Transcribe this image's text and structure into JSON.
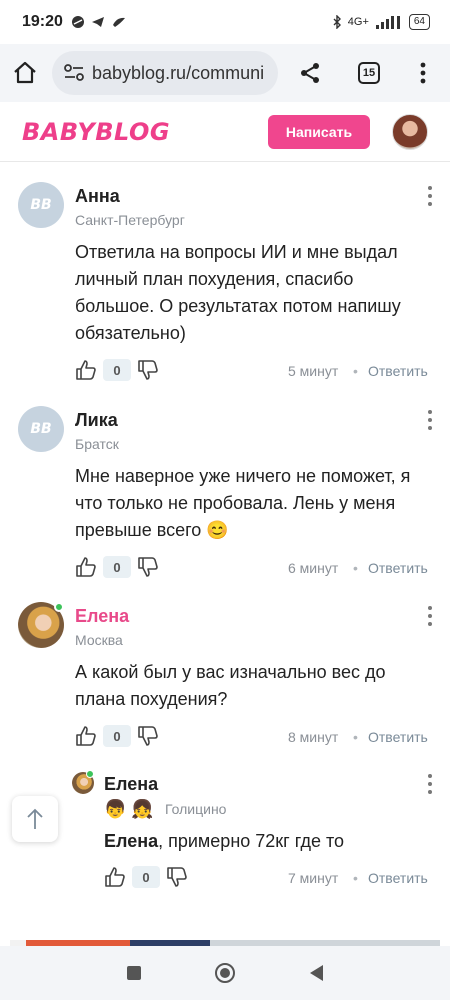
{
  "status_bar": {
    "time": "19:20",
    "battery": "64",
    "network": "4G+"
  },
  "browser": {
    "url": "babyblog.ru/communi",
    "tab_count": "15"
  },
  "header": {
    "logo": "BABYBLOG",
    "write_button": "Написать"
  },
  "comments": [
    {
      "author": "Анна",
      "city": "Санкт-Петербург",
      "avatar": "BB",
      "text": "Ответила на вопросы ИИ и мне выдал личный план похудения, спасибо большое. О результатах потом напишу обязательно)",
      "votes": "0",
      "time": "5 минут",
      "reply": "Ответить"
    },
    {
      "author": "Лика",
      "city": "Братск",
      "avatar": "BB",
      "text": "Мне наверное уже ничего не поможет, я что только не пробовала. Лень у меня превыше всего 😊",
      "votes": "0",
      "time": "6 минут",
      "reply": "Ответить"
    },
    {
      "author": "Елена",
      "city": "Москва",
      "text": "А какой был у вас изначально вес до плана похудения?",
      "votes": "0",
      "time": "8 минут",
      "reply": "Ответить"
    }
  ],
  "reply": {
    "author": "Елена",
    "city": "Голицино",
    "mention": "Елена",
    "text": ", примерно 72кг где то",
    "votes": "0",
    "time": "7 минут",
    "reply": "Ответить"
  },
  "colors": {
    "brand_pink": "#f0468e",
    "online_green": "#3cc35a"
  }
}
